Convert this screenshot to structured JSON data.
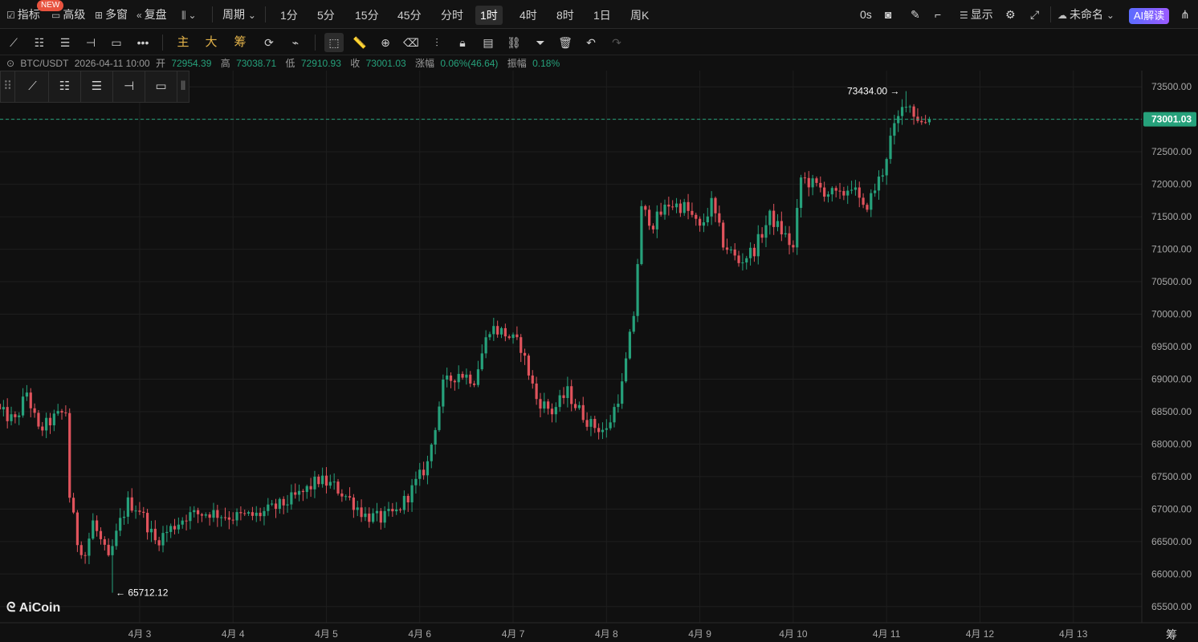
{
  "topbar": {
    "indicators": "指标",
    "new_badge": "NEW",
    "advanced": "高级",
    "multi_window": "多窗",
    "replay": "复盘",
    "period_label": "周期",
    "periods": [
      "1分",
      "5分",
      "15分",
      "45分",
      "分时",
      "1时",
      "4时",
      "8时",
      "1日",
      "周K"
    ],
    "active_period": "1时",
    "timer": "0s",
    "display": "显示",
    "unnamed": "未命名",
    "ai_button": "AI解读"
  },
  "toolbar": {
    "main_label": "主",
    "big_label": "大",
    "chips_label": "筹"
  },
  "info": {
    "symbol": "BTC/USDT",
    "datetime": "2026-04-11 10:00",
    "open_label": "开",
    "open": "72954.39",
    "high_label": "高",
    "high": "73038.71",
    "low_label": "低",
    "low": "72910.93",
    "close_label": "收",
    "close": "73001.03",
    "change_label": "涨幅",
    "change": "0.06%(46.64)",
    "amplitude_label": "振幅",
    "amplitude": "0.18%"
  },
  "logo_text": "AiCoin",
  "corner_text": "筹 爆",
  "colors": {
    "up": "#26a17b",
    "down": "#e0535c",
    "background": "#101010",
    "grid": "#1e1e1e",
    "price_tag": "#26a17b"
  },
  "chart_data": {
    "type": "candlestick",
    "symbol": "BTC/USDT",
    "interval": "1时",
    "ylim": [
      65250,
      73750
    ],
    "y_ticks": [
      65500,
      66000,
      66500,
      67000,
      67500,
      68000,
      68500,
      69000,
      69500,
      70000,
      70500,
      71000,
      71500,
      72000,
      72500,
      73000,
      73500
    ],
    "y_tick_labels": [
      "65500.00",
      "66000.00",
      "66500.00",
      "67000.00",
      "67500.00",
      "68000.00",
      "68500.00",
      "69000.00",
      "69500.00",
      "70000.00",
      "70500.00",
      "71000.00",
      "71500.00",
      "72000.00",
      "72500.00",
      "73000.00",
      "73500.00"
    ],
    "x_start_hour_index": 0,
    "x_day_ticks": [
      {
        "label": "4月 3",
        "hour_index": 36
      },
      {
        "label": "4月 4",
        "hour_index": 60
      },
      {
        "label": "4月 5",
        "hour_index": 84
      },
      {
        "label": "4月 6",
        "hour_index": 108
      },
      {
        "label": "4月 7",
        "hour_index": 132
      },
      {
        "label": "4月 8",
        "hour_index": 156
      },
      {
        "label": "4月 9",
        "hour_index": 180
      },
      {
        "label": "4月 10",
        "hour_index": 204
      },
      {
        "label": "4月 11",
        "hour_index": 228
      },
      {
        "label": "4月 12",
        "hour_index": 252
      },
      {
        "label": "4月 13",
        "hour_index": 276
      }
    ],
    "last_price": 73001.03,
    "last_price_label": "73001.03",
    "max_marker": {
      "label": "73434.00",
      "value": 73434.0,
      "hour_index": 233
    },
    "min_marker": {
      "label": "65712.12",
      "value": 65712.12,
      "hour_index": 29
    },
    "close_anchors": [
      [
        0,
        68500
      ],
      [
        4,
        68350
      ],
      [
        7,
        68800
      ],
      [
        10,
        68200
      ],
      [
        14,
        68400
      ],
      [
        17,
        68500
      ],
      [
        18,
        67200
      ],
      [
        20,
        66500
      ],
      [
        22,
        66300
      ],
      [
        24,
        66800
      ],
      [
        26,
        66500
      ],
      [
        28,
        66200
      ],
      [
        30,
        66600
      ],
      [
        31,
        66800
      ],
      [
        33,
        67100
      ],
      [
        36,
        67000
      ],
      [
        40,
        66500
      ],
      [
        44,
        66700
      ],
      [
        48,
        66900
      ],
      [
        54,
        66950
      ],
      [
        60,
        66880
      ],
      [
        66,
        66900
      ],
      [
        72,
        67050
      ],
      [
        78,
        67250
      ],
      [
        82,
        67450
      ],
      [
        86,
        67350
      ],
      [
        90,
        67150
      ],
      [
        94,
        66900
      ],
      [
        98,
        66850
      ],
      [
        102,
        66950
      ],
      [
        106,
        67300
      ],
      [
        110,
        67700
      ],
      [
        114,
        68900
      ],
      [
        118,
        69100
      ],
      [
        122,
        69000
      ],
      [
        126,
        69800
      ],
      [
        130,
        69700
      ],
      [
        134,
        69500
      ],
      [
        138,
        68700
      ],
      [
        142,
        68500
      ],
      [
        146,
        68800
      ],
      [
        148,
        68600
      ],
      [
        152,
        68300
      ],
      [
        156,
        68200
      ],
      [
        160,
        68900
      ],
      [
        163,
        70000
      ],
      [
        165,
        71600
      ],
      [
        168,
        71400
      ],
      [
        172,
        71700
      ],
      [
        176,
        71650
      ],
      [
        178,
        71500
      ],
      [
        180,
        71300
      ],
      [
        183,
        71700
      ],
      [
        186,
        71100
      ],
      [
        190,
        70800
      ],
      [
        194,
        71000
      ],
      [
        198,
        71500
      ],
      [
        202,
        71200
      ],
      [
        204,
        71000
      ],
      [
        206,
        72100
      ],
      [
        209,
        72000
      ],
      [
        212,
        71900
      ],
      [
        216,
        71800
      ],
      [
        219,
        72000
      ],
      [
        222,
        71600
      ],
      [
        224,
        71800
      ],
      [
        227,
        72200
      ],
      [
        229,
        72700
      ],
      [
        231,
        73000
      ],
      [
        233,
        73300
      ],
      [
        235,
        73100
      ],
      [
        237,
        72950
      ],
      [
        239,
        73001
      ]
    ]
  }
}
